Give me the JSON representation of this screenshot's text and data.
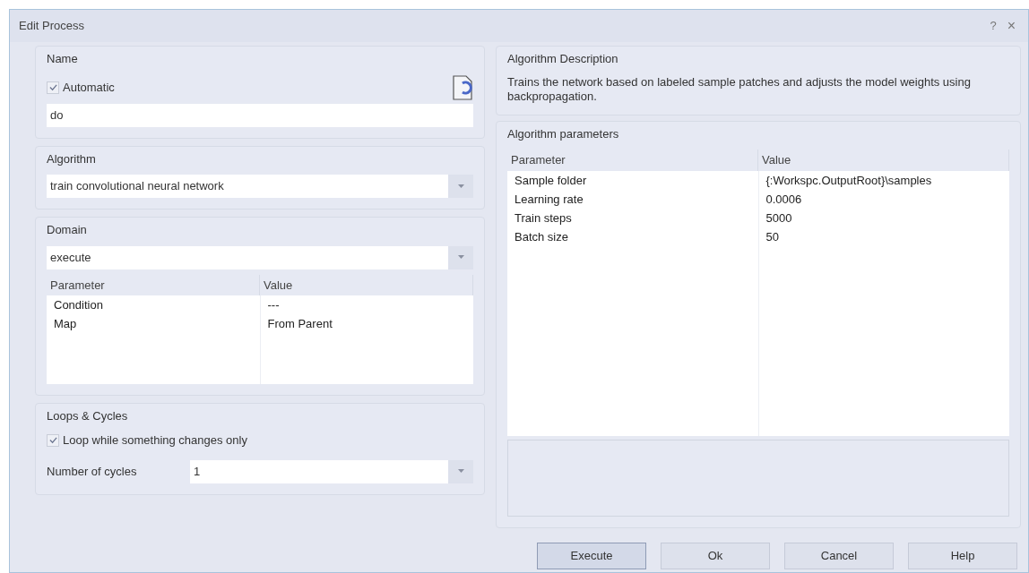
{
  "window": {
    "title": "Edit Process",
    "help": "?",
    "close": "×"
  },
  "name_group": {
    "title": "Name",
    "automatic": {
      "label": "Automatic",
      "checked": true
    },
    "value": "do"
  },
  "algorithm_group": {
    "title": "Algorithm",
    "value": "train convolutional neural network"
  },
  "domain_group": {
    "title": "Domain",
    "value": "execute",
    "columns": [
      "Parameter",
      "Value"
    ],
    "rows": [
      {
        "parameter": "Condition",
        "value": "---"
      },
      {
        "parameter": "Map",
        "value": "From Parent"
      }
    ]
  },
  "loops_group": {
    "title": "Loops & Cycles",
    "loop_option": {
      "label": "Loop while something changes only",
      "checked": true
    },
    "cycles_label": "Number of cycles",
    "cycles_value": "1"
  },
  "description_group": {
    "title": "Algorithm Description",
    "text": "Trains the network based on labeled sample patches and adjusts the model weights using backpropagation."
  },
  "parameters_group": {
    "title": "Algorithm parameters",
    "columns": [
      "Parameter",
      "Value"
    ],
    "rows": [
      {
        "parameter": "Sample folder",
        "value": "{:Workspc.OutputRoot}\\samples"
      },
      {
        "parameter": "Learning rate",
        "value": "0.0006"
      },
      {
        "parameter": "Train steps",
        "value": "5000"
      },
      {
        "parameter": "Batch size",
        "value": "50"
      }
    ]
  },
  "buttons": [
    {
      "label": "Execute",
      "selected": true
    },
    {
      "label": "Ok",
      "selected": false
    },
    {
      "label": "Cancel",
      "selected": false
    },
    {
      "label": "Help",
      "selected": false
    }
  ]
}
